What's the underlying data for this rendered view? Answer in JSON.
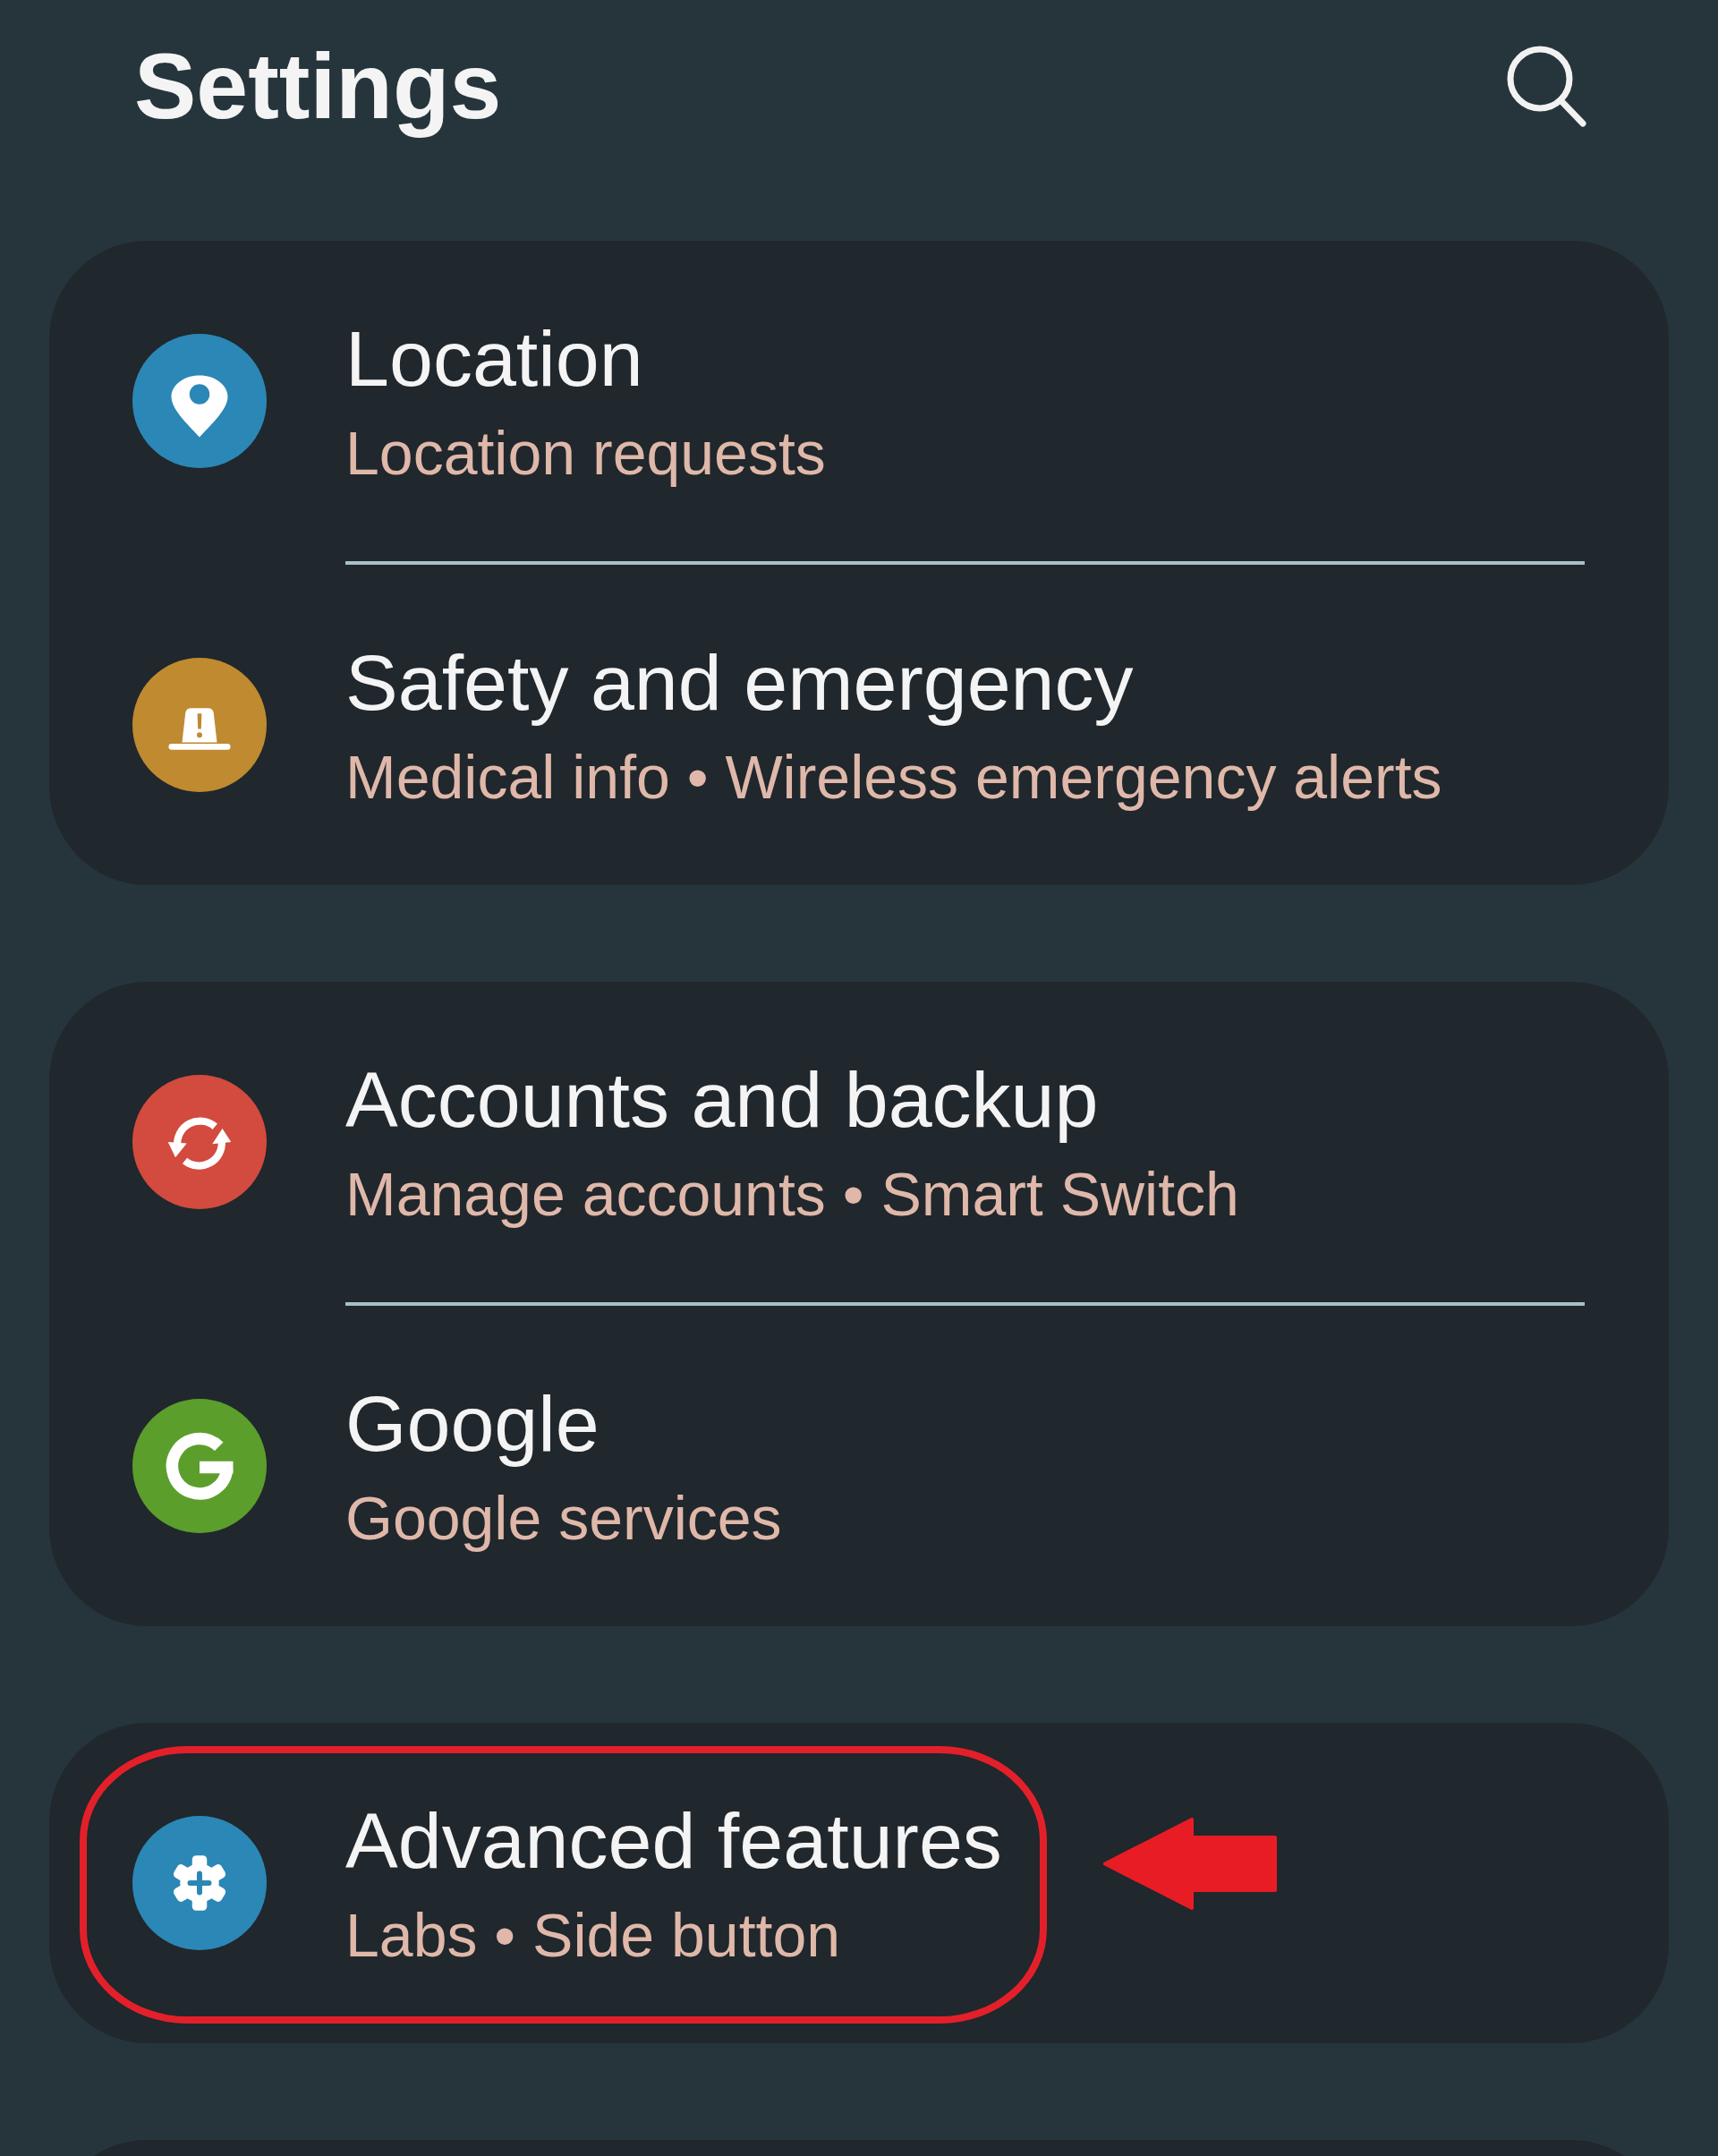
{
  "header": {
    "title": "Settings"
  },
  "sections": [
    {
      "items": [
        {
          "title": "Location",
          "subtitle": "Location requests",
          "color": "#2b87b5",
          "highlighted": false
        },
        {
          "title": "Safety and emergency",
          "subtitle": "Medical info • Wireless emergency alerts",
          "color": "#bf8a30",
          "highlighted": false
        }
      ]
    },
    {
      "items": [
        {
          "title": "Accounts and backup",
          "subtitle": "Manage accounts • Smart Switch",
          "color": "#d24b3e",
          "highlighted": false
        },
        {
          "title": "Google",
          "subtitle": "Google services",
          "color": "#5b9e2c",
          "highlighted": false
        }
      ]
    },
    {
      "items": [
        {
          "title": "Advanced features",
          "subtitle": "Labs • Side button",
          "color": "#2b87b5",
          "highlighted": true
        }
      ]
    }
  ]
}
